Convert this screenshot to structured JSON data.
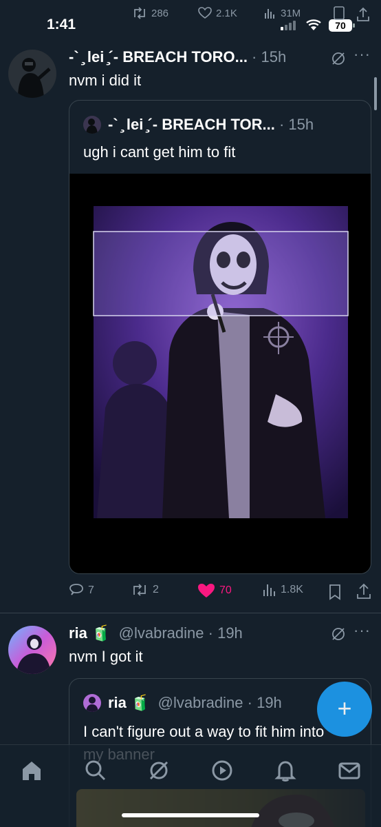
{
  "status_bar": {
    "time": "1:41",
    "battery": "70",
    "top_stats": {
      "retweets": "286",
      "likes": "2.1K",
      "views": "31M"
    }
  },
  "tweets": [
    {
      "display_name": "-` ̧ lei ̧´- BREACH TORO...",
      "time": "15h",
      "text": "nvm i did it",
      "quote": {
        "display_name": "-` ̧ lei ̧´- BREACH TOR...",
        "time": "15h",
        "text": "ugh i cant get him to fit"
      },
      "actions": {
        "replies": "7",
        "retweets": "2",
        "likes": "70",
        "views": "1.8K"
      }
    },
    {
      "display_name": "ria 🧃",
      "handle": "@lvabradine",
      "time": "19h",
      "text": "nvm I got it",
      "quote": {
        "display_name": "ria 🧃",
        "handle": "@lvabradine",
        "time": "19h",
        "text": "I can't figure out a way to fit him into my banner"
      }
    }
  ],
  "fab": {
    "label": "+"
  },
  "colors": {
    "background": "#15202b",
    "accent": "#1d9bf0",
    "like": "#f91880",
    "muted": "#8b98a5"
  },
  "icons": [
    "home-icon",
    "search-icon",
    "grok-icon",
    "video-icon",
    "bell-icon",
    "mail-icon"
  ]
}
